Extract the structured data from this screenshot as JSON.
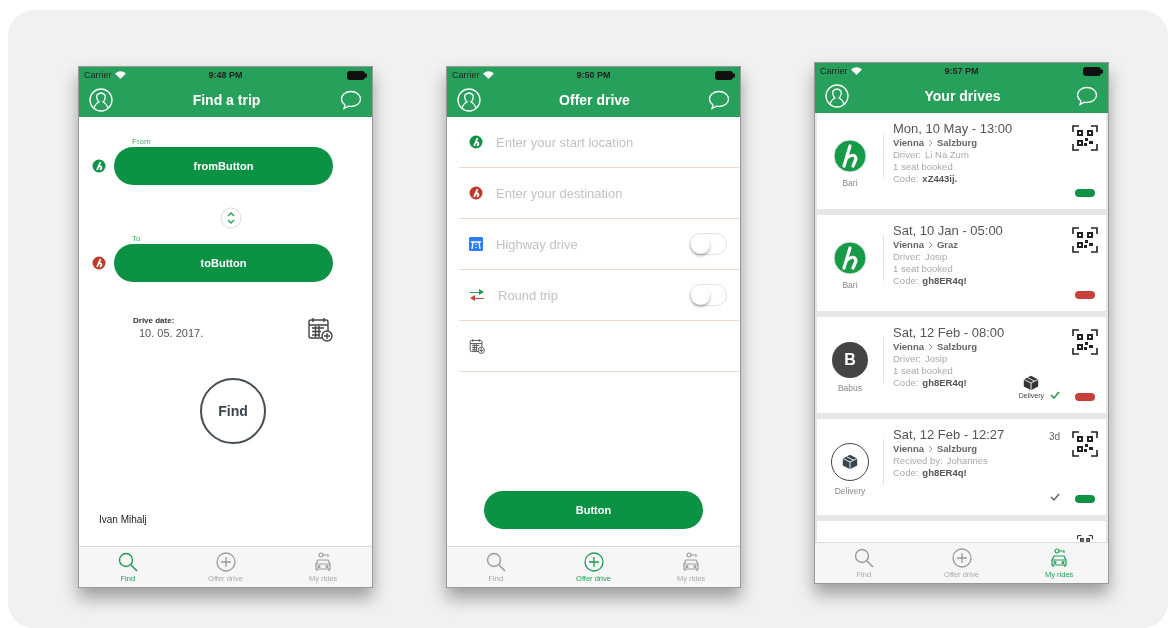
{
  "screens": [
    {
      "kind": "find",
      "status_bar": {
        "carrier": "Carrier",
        "time": "9:48 PM"
      },
      "title": "Find a trip",
      "from": {
        "label": "From",
        "button": "fromButton",
        "color": "#0e9244"
      },
      "to": {
        "label": "To",
        "button": "toButton",
        "color": "#c0392b"
      },
      "date": {
        "label": "Drive date:",
        "value": "10. 05. 2017."
      },
      "find_button": "Find",
      "user_name": "Ivan Mihalj",
      "tabs": [
        {
          "label": "Find",
          "selected": true
        },
        {
          "label": "Offer drive",
          "selected": false
        },
        {
          "label": "My rides",
          "selected": false
        }
      ]
    },
    {
      "kind": "offer",
      "status_bar": {
        "carrier": "Carrier",
        "time": "9:50 PM"
      },
      "title": "Offer drive",
      "rows": [
        {
          "kind": "location",
          "placeholder": "Enter your start location",
          "color": "#0e9244"
        },
        {
          "kind": "location",
          "placeholder": "Enter your destination",
          "color": "#c0392b"
        },
        {
          "kind": "toggle",
          "label": "Highway drive",
          "on": false
        },
        {
          "kind": "toggle",
          "label": "Round trip",
          "on": false
        },
        {
          "kind": "date"
        }
      ],
      "button": "Button",
      "tabs": [
        {
          "label": "Find",
          "selected": false
        },
        {
          "label": "Offer drive",
          "selected": true
        },
        {
          "label": "My rides",
          "selected": false
        }
      ]
    },
    {
      "kind": "drives",
      "status_bar": {
        "carrier": "Carrier",
        "time": "9:57 PM"
      },
      "title": "Your drives",
      "drives": [
        {
          "avatar": {
            "kind": "logo",
            "label": "Bari"
          },
          "date": "Mon, 10 May - 13:00",
          "from": "Vienna",
          "to": "Salzburg",
          "person_label": "Driver:",
          "person": "Li Na Zum",
          "seats": "1 seat booked",
          "code_label": "Code:",
          "code": "xZ443ij.",
          "status": {
            "color": "#0e9244"
          }
        },
        {
          "avatar": {
            "kind": "logo",
            "label": "Bari"
          },
          "date": "Sat, 10 Jan - 05:00",
          "from": "Vienna",
          "to": "Graz",
          "person_label": "Driver:",
          "person": "Josip",
          "seats": "1 seat booked",
          "code_label": "Code:",
          "code": "gh8ER4q!",
          "status": {
            "color": "#c9403a"
          }
        },
        {
          "avatar": {
            "kind": "letter",
            "letter": "B",
            "label": "Babus"
          },
          "date": "Sat, 12 Feb - 08:00",
          "from": "Vienna",
          "to": "Salzburg",
          "person_label": "Driver:",
          "person": "Josip",
          "seats": "1 seat booked",
          "code_label": "Code:",
          "code": "gh8ER4q!",
          "delivery": {
            "label": "Delivery"
          },
          "check": {
            "color": "#1f9a44"
          },
          "status": {
            "color": "#c9403a"
          }
        },
        {
          "avatar": {
            "kind": "delivery",
            "label": "Delivery"
          },
          "date": "Sat, 12 Feb - 12:27",
          "age": "3d",
          "from": "Vienna",
          "to": "Salzburg",
          "person_label": "Recived by:",
          "person": "Johannes",
          "code_label": "Code:",
          "code": "gh8ER4q!",
          "check": {
            "color": "#666666"
          },
          "status": {
            "color": "#0e9244"
          }
        }
      ],
      "tabs": [
        {
          "label": "Find",
          "selected": false
        },
        {
          "label": "Offer drive",
          "selected": false
        },
        {
          "label": "My rides",
          "selected": true
        }
      ]
    }
  ]
}
